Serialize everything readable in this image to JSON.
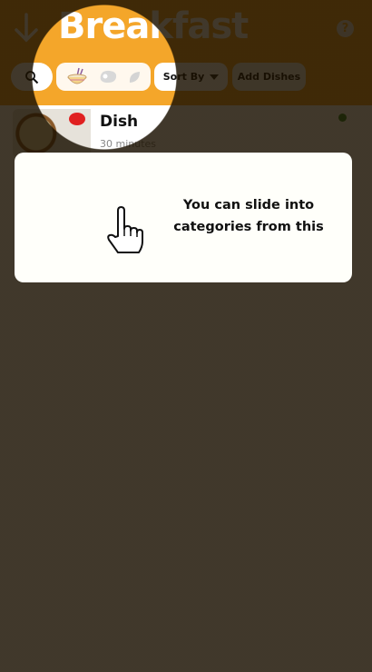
{
  "header": {
    "title": "Breakfast",
    "back_icon": "arrow-down-icon",
    "help_label": "?"
  },
  "toolbar": {
    "search_icon": "search-icon",
    "categories": [
      "rice-bowl-icon",
      "meat-icon",
      "leaf-icon"
    ],
    "sort_label": "Sort By",
    "add_label": "Add Dishes"
  },
  "dishes": [
    {
      "name": "Dish",
      "time": "30 minutes",
      "status_color": "#2c8a2c"
    }
  ],
  "tooltip": {
    "text": "You can slide into categories from this",
    "icon": "pointing-hand-icon"
  },
  "colors": {
    "accent": "#f4a62a"
  }
}
